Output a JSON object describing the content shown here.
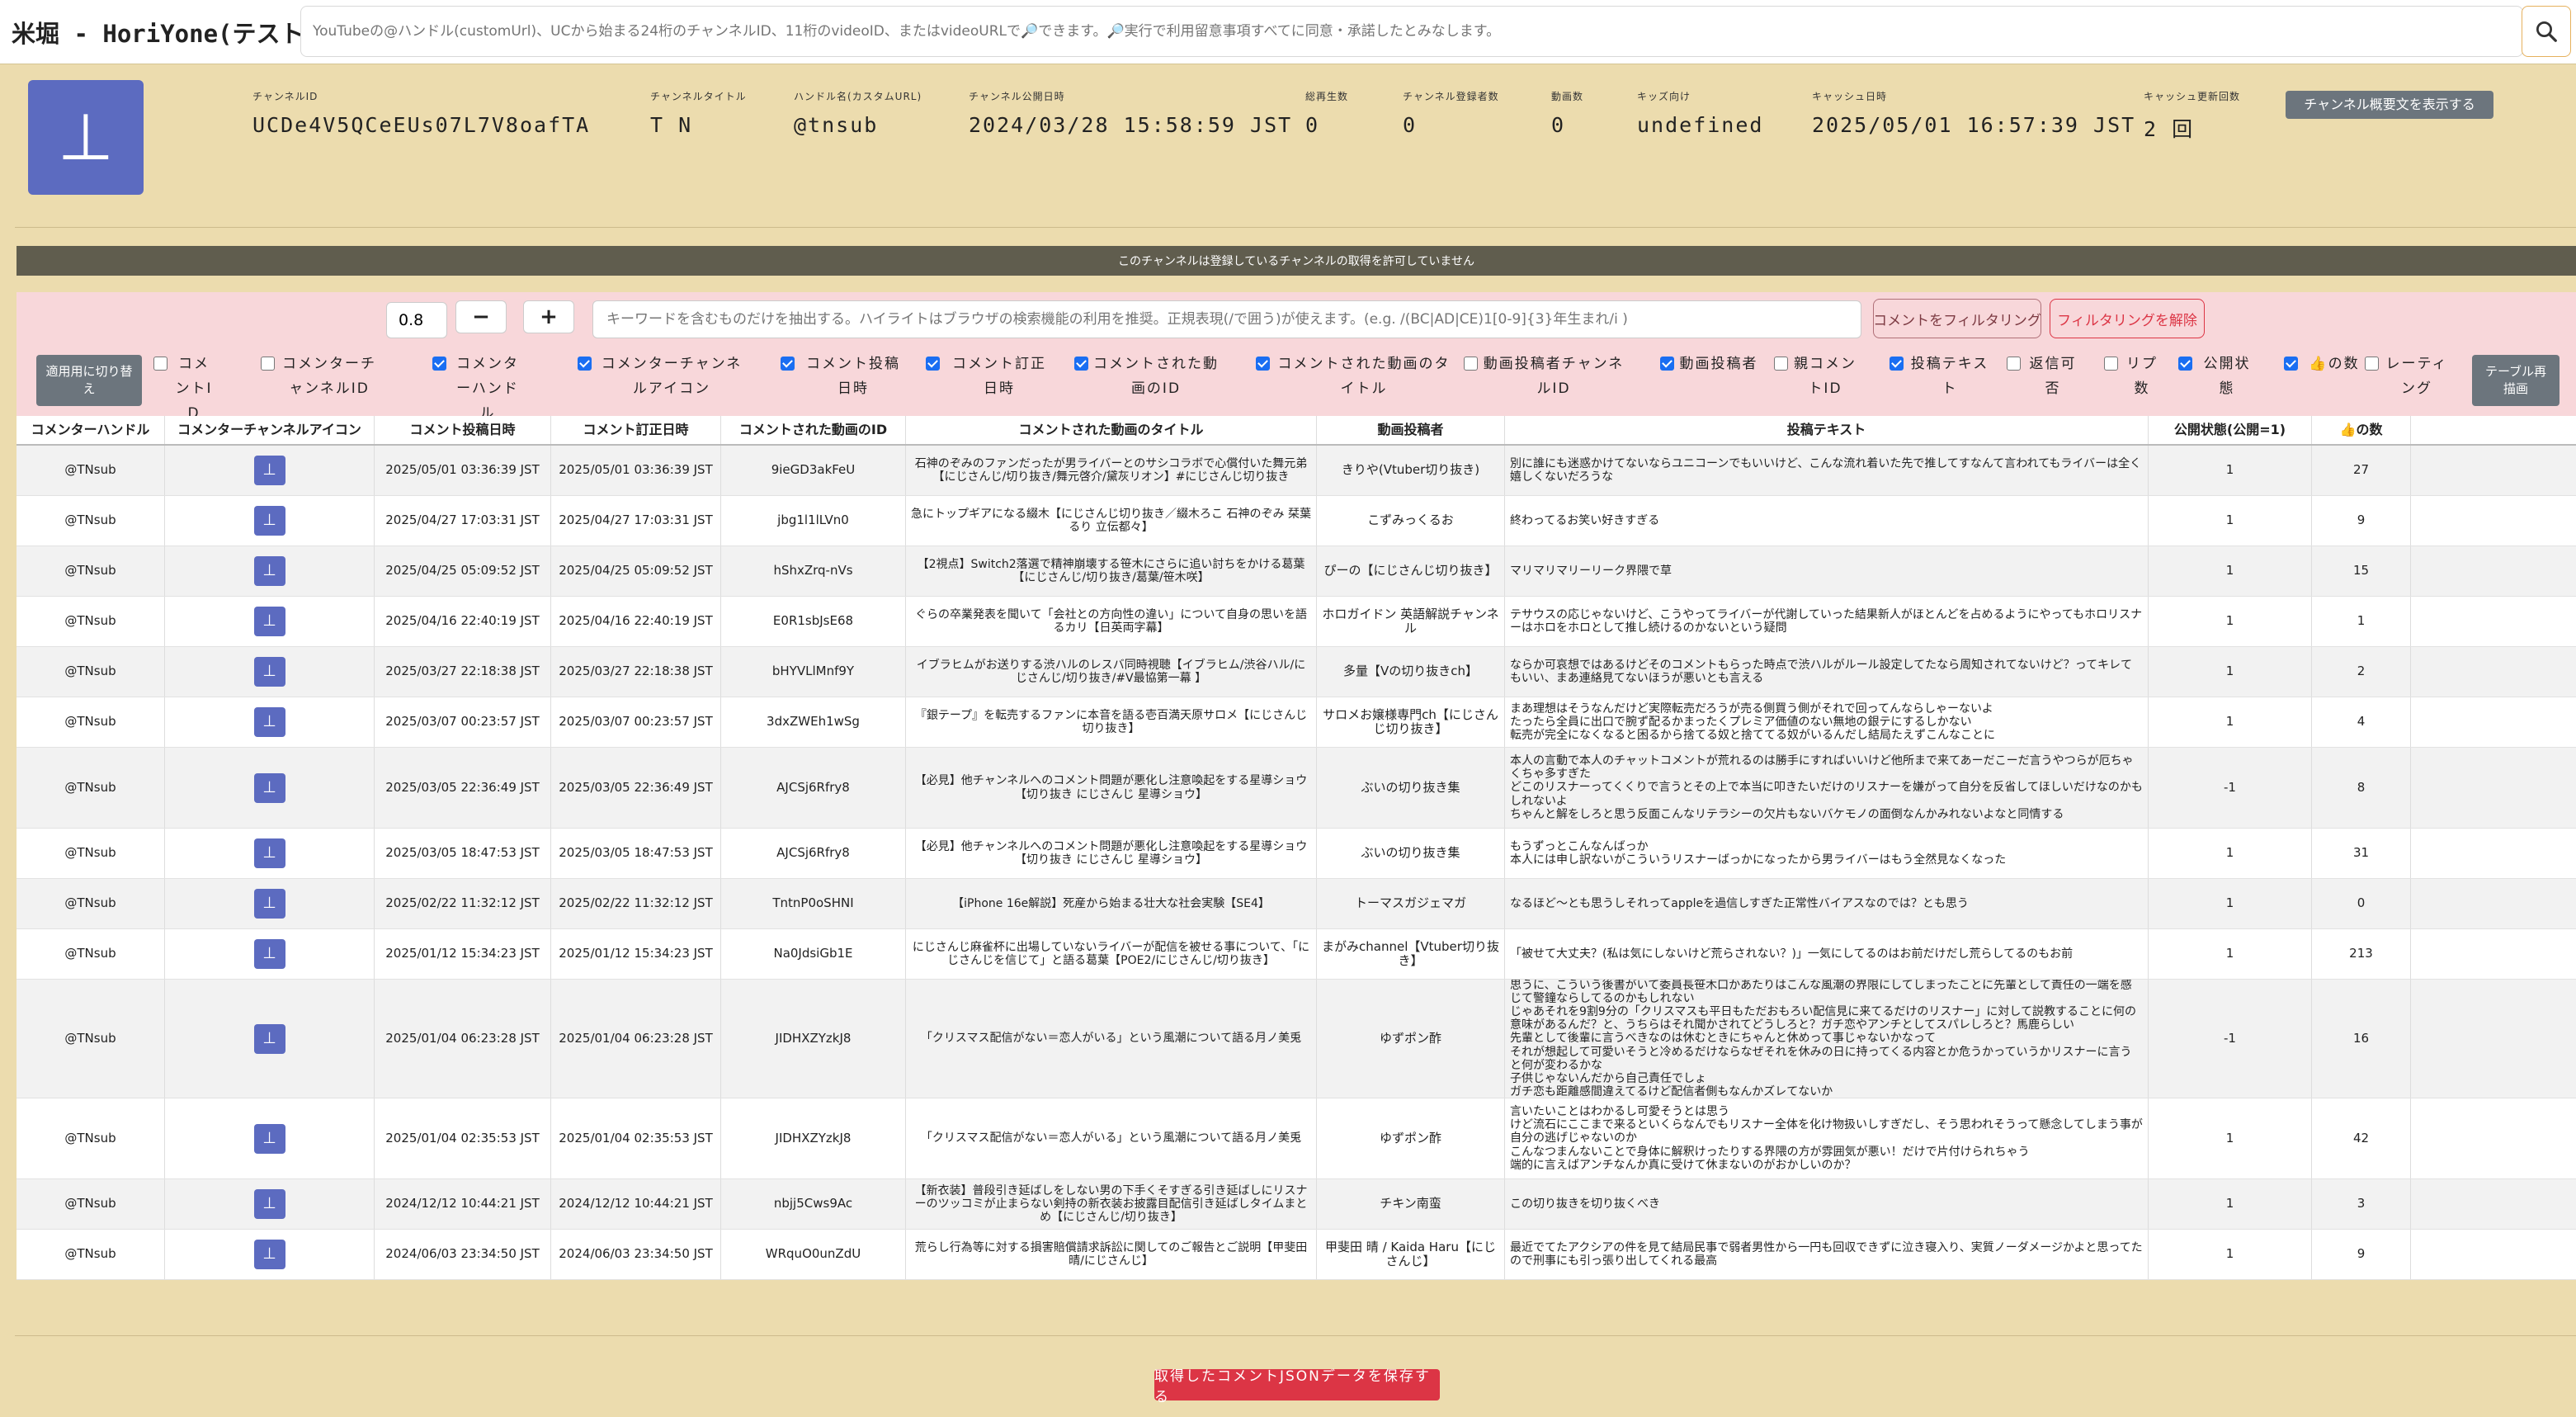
{
  "app": {
    "title": "米堀 - HoriYone(テスト中)",
    "search_placeholder": "YouTubeの@ハンドル(customUrl)、UCから始まる24桁のチャンネルID、11桁のvideoID、またはvideoURLで🔎できます。🔎実行で利用留意事項すべてに同意・承諾したとみなします。",
    "search_icon": "search-icon"
  },
  "channel": {
    "avatar_char": "⊥",
    "fields": [
      {
        "label": "チャンネルID",
        "value": "UCDe4V5QCeEUs07L7V8oafTA"
      },
      {
        "label": "チャンネルタイトル",
        "value": "T N"
      },
      {
        "label": "ハンドル名(カスタムURL)",
        "value": "@tnsub"
      },
      {
        "label": "チャンネル公開日時",
        "value": "2024/03/28 15:58:59 JST"
      },
      {
        "label": "総再生数",
        "value": "0"
      },
      {
        "label": "チャンネル登録者数",
        "value": "0"
      },
      {
        "label": "動画数",
        "value": "0"
      },
      {
        "label": "キッズ向け",
        "value": "undefined"
      },
      {
        "label": "キャッシュ日時",
        "value": "2025/05/01 16:57:39 JST"
      },
      {
        "label": "キャッシュ更新回数",
        "value": "2 回"
      }
    ],
    "show_desc_label": "チャンネル概要文を表示する"
  },
  "banner": "このチャンネルは登録しているチャンネルの取得を許可していません",
  "filter": {
    "zoom_value": "0.8",
    "minus_label": "−",
    "plus_label": "+",
    "keyword_placeholder": "キーワードを含むものだけを抽出する。ハイライトはブラウザの検索機能の利用を推奨。正規表現(/で囲う)が使えます。(e.g. /(BC|AD|CE)1[0-9]{3}年生まれ/i )",
    "filter_btn": "コメントをフィルタリング",
    "clear_btn": "フィルタリングを解除",
    "apply_btn": "適用用に切り替え",
    "redraw_btn": "テーブル再描画"
  },
  "column_toggles": [
    {
      "label": "コメントID",
      "checked": false
    },
    {
      "label": "コメンターチャンネルID",
      "checked": false
    },
    {
      "label": "コメンターハンドル",
      "checked": true
    },
    {
      "label": "コメンターチャンネルアイコン",
      "checked": true
    },
    {
      "label": "コメント投稿日時",
      "checked": true
    },
    {
      "label": "コメント訂正日時",
      "checked": true
    },
    {
      "label": "コメントされた動画のID",
      "checked": true
    },
    {
      "label": "コメントされた動画のタイトル",
      "checked": true
    },
    {
      "label": "動画投稿者チャンネルID",
      "checked": false
    },
    {
      "label": "動画投稿者",
      "checked": true
    },
    {
      "label": "親コメントID",
      "checked": false
    },
    {
      "label": "投稿テキスト",
      "checked": true
    },
    {
      "label": "返信可否",
      "checked": false
    },
    {
      "label": "リプ数",
      "checked": false
    },
    {
      "label": "公開状態",
      "checked": true
    },
    {
      "label": "👍の数",
      "checked": true
    },
    {
      "label": "レーティング",
      "checked": false
    }
  ],
  "table": {
    "headers": [
      "コメンターハンドル",
      "コメンターチャンネルアイコン",
      "コメント投稿日時",
      "コメント訂正日時",
      "コメントされた動画のID",
      "コメントされた動画のタイトル",
      "動画投稿者",
      "投稿テキスト",
      "公開状態(公開=1)",
      "👍の数"
    ],
    "rows": [
      {
        "handle": "@TNsub",
        "icon": "⊥",
        "posted": "2025/05/01 03:36:39 JST",
        "edited": "2025/05/01 03:36:39 JST",
        "video_id": "9ieGD3akFeU",
        "title": "石神のぞみのファンだったが男ライバーとのサシコラボで心償付いた舞元弟【にじさんじ/切り抜き/舞元啓介/黛灰リオン】#にじさんじ切り抜き",
        "uploader": "きりや(Vtuber切り抜き)",
        "text": "別に誰にも迷惑かけてないならユニコーンでもいいけど、こんな流れ着いた先で推してすなんて言われてもライバーは全く嬉しくないだろうな",
        "public": "1",
        "likes": "27"
      },
      {
        "handle": "@TNsub",
        "icon": "⊥",
        "posted": "2025/04/27 17:03:31 JST",
        "edited": "2025/04/27 17:03:31 JST",
        "video_id": "jbg1l1lLVn0",
        "title": "急にトップギアになる綴木【にじさんじ切り抜き／綴木ろこ 石神のぞみ 栞葉るり 立伝都々】",
        "uploader": "こずみっくるお",
        "text": "終わってるお笑い好きすぎる",
        "public": "1",
        "likes": "9"
      },
      {
        "handle": "@TNsub",
        "icon": "⊥",
        "posted": "2025/04/25 05:09:52 JST",
        "edited": "2025/04/25 05:09:52 JST",
        "video_id": "hShxZrq-nVs",
        "title": "【2視点】Switch2落選で精神崩壊する笹木にさらに追い討ちをかける葛葉【にじさんじ/切り抜き/葛葉/笹木咲】",
        "uploader": "ぴーの【にじさんじ切り抜き】",
        "text": "マリマリマリーリーク界隈で草",
        "public": "1",
        "likes": "15"
      },
      {
        "handle": "@TNsub",
        "icon": "⊥",
        "posted": "2025/04/16 22:40:19 JST",
        "edited": "2025/04/16 22:40:19 JST",
        "video_id": "E0R1sbJsE68",
        "title": "ぐらの卒業発表を聞いて「会社との方向性の違い」について自身の思いを語るカリ【日英両字幕】",
        "uploader": "ホロガイドン 英語解説チャンネル",
        "text": "テサウスの応じゃないけど、こうやってライバーが代謝していった結果新人がほとんどを占めるようにやってもホロリスナーはホロをホロとして推し続けるのかないという疑問",
        "public": "1",
        "likes": "1"
      },
      {
        "handle": "@TNsub",
        "icon": "⊥",
        "posted": "2025/03/27 22:18:38 JST",
        "edited": "2025/03/27 22:18:38 JST",
        "video_id": "bHYVLlMnf9Y",
        "title": "イブラヒムがお送りする渋ハルのレスバ同時視聴【イブラヒム/渋谷ハル/にじさんじ/切り抜き/#V最協第一幕 】",
        "uploader": "多量【Vの切り抜きch】",
        "text": "ならか可哀想ではあるけどそのコメントもらった時点で渋ハルがルール設定してたなら周知されてないけど？ってキレてもいい、まあ連絡見てないほうが悪いとも言える",
        "public": "1",
        "likes": "2"
      },
      {
        "handle": "@TNsub",
        "icon": "⊥",
        "posted": "2025/03/07 00:23:57 JST",
        "edited": "2025/03/07 00:23:57 JST",
        "video_id": "3dxZWEh1wSg",
        "title": "『銀テープ』を転売するファンに本音を語る壱百満天原サロメ【にじさんじ切り抜き】",
        "uploader": "サロメお嬢様専門ch【にじさんじ切り抜き】",
        "text": "まあ理想はそうなんだけど実際転売だろうが売る側買う側がそれで回ってんならしゃーないよ\nたったら全員に出口で腕ず配るかまったくプレミア価値のない無地の銀テにするしかない\n転売が完全になくなると困るから捨てる奴と捨ててる奴がいるんだし結局たえずこんなことに",
        "public": "1",
        "likes": "4"
      },
      {
        "handle": "@TNsub",
        "icon": "⊥",
        "posted": "2025/03/05 22:36:49 JST",
        "edited": "2025/03/05 22:36:49 JST",
        "video_id": "AJCSj6Rfry8",
        "title": "【必見】他チャンネルへのコメント問題が悪化し注意喚起をする星導ショウ【切り抜き にじさんじ 星導ショウ】",
        "uploader": "ぶいの切り抜き集",
        "text": "本人の言動で本人のチャットコメントが荒れるのは勝手にすればいいけど他所まで来てあーだこーだ言うやつらが厄ちゃくちゃ多すぎた\nどこのリスナーってくくりで言うとその上で本当に叩きたいだけのリスナーを嫌がって自分を反省してほしいだけなのかもしれないよ\nちゃんと解をしろと思う反面こんなリテラシーの欠片もないバケモノの面倒なんかみれないよなと同情する",
        "public": "-1",
        "likes": "8"
      },
      {
        "handle": "@TNsub",
        "icon": "⊥",
        "posted": "2025/03/05 18:47:53 JST",
        "edited": "2025/03/05 18:47:53 JST",
        "video_id": "AJCSj6Rfry8",
        "title": "【必見】他チャンネルへのコメント問題が悪化し注意喚起をする星導ショウ【切り抜き にじさんじ 星導ショウ】",
        "uploader": "ぶいの切り抜き集",
        "text": "もうずっとこんなんばっか\n本人には申し訳ないがこういうリスナーばっかになったから男ライバーはもう全然見なくなった",
        "public": "1",
        "likes": "31"
      },
      {
        "handle": "@TNsub",
        "icon": "⊥",
        "posted": "2025/02/22 11:32:12 JST",
        "edited": "2025/02/22 11:32:12 JST",
        "video_id": "TntnP0oSHNI",
        "title": "【iPhone 16e解説】死産から始まる壮大な社会実験【SE4】",
        "uploader": "トーマスガジェマガ",
        "text": "なるほど～とも思うしそれってappleを過信しすぎた正常性バイアスなのでは？とも思う",
        "public": "1",
        "likes": "0"
      },
      {
        "handle": "@TNsub",
        "icon": "⊥",
        "posted": "2025/01/12 15:34:23 JST",
        "edited": "2025/01/12 15:34:23 JST",
        "video_id": "Na0JdsiGb1E",
        "title": "にじさんじ麻雀杯に出場していないライバーが配信を被せる事について、「にじさんじを信じて」と語る葛葉【POE2/にじさんじ/切り抜き】",
        "uploader": "まがみchannel【Vtuber切り抜き】",
        "text": "「被せて大丈夫？(私は気にしないけど荒らされない？)」一気にしてるのはお前だけだし荒らしてるのもお前",
        "public": "1",
        "likes": "213"
      },
      {
        "handle": "@TNsub",
        "icon": "⊥",
        "posted": "2025/01/04 06:23:28 JST",
        "edited": "2025/01/04 06:23:28 JST",
        "video_id": "JIDHXZYzkJ8",
        "title": "「クリスマス配信がない＝恋人がいる」という風潮について語る月ノ美兎",
        "uploader": "ゆずポン酢",
        "text": "思うに、こういう後書がいて委員長笹木口かあたりはこんな風潮の界限にしてしまったことに先輩として責任の一端を感じて警鐘ならしてるのかもしれない\nじゃあそれを9割9分の「クリスマスも平日もただおもろい配信見に来てるだけのリスナー」に対して説教することに何の意味があるんだ？と、うちらはそれ聞かされてどうしろと？ガチ恋やアンチとしてスパレしろと？馬鹿らしい\n先輩として後輩に言うべきなのは休むときにちゃんと休めって事じゃないかなって\nそれが想起して可愛いそうと冷めるだけならなぜそれを休みの日に持ってくる内容とか危うかっていうかリスナーに言うと何が変わるかな\n子供じゃないんだから自己責任でしょ\nガチ恋も距離感間違えてるけど配信者側もなんかズレてないか",
        "public": "-1",
        "likes": "16"
      },
      {
        "handle": "@TNsub",
        "icon": "⊥",
        "posted": "2025/01/04 02:35:53 JST",
        "edited": "2025/01/04 02:35:53 JST",
        "video_id": "JIDHXZYzkJ8",
        "title": "「クリスマス配信がない＝恋人がいる」という風潮について語る月ノ美兎",
        "uploader": "ゆずポン酢",
        "text": "言いたいことはわかるし可愛そうとは思う\nけど流石にここまで来るといくらなんでもリスナー全体を化け物扱いしすぎだし、そう思われそうって懸念してしまう事が自分の逃げじゃないのか\nこんなつまんないことで身体に解釈けったりする界隈の方が雰囲気が悪い！だけで片付けられちゃう\n端的に言えばアンチなんか真に受けて休まないのがおかしいのか？",
        "public": "1",
        "likes": "42"
      },
      {
        "handle": "@TNsub",
        "icon": "⊥",
        "posted": "2024/12/12 10:44:21 JST",
        "edited": "2024/12/12 10:44:21 JST",
        "video_id": "nbjj5Cws9Ac",
        "title": "【新衣装】普段引き延ばしをしない男の下手くそすぎる引き延ばしにリスナーのツッコミが止まらない剣持の新衣装お披露目配信引き延ばしタイムまとめ【にじさんじ/切り抜き】",
        "uploader": "チキン南蛮",
        "text": "この切り抜きを切り抜くべき",
        "public": "1",
        "likes": "3"
      },
      {
        "handle": "@TNsub",
        "icon": "⊥",
        "posted": "2024/06/03 23:34:50 JST",
        "edited": "2024/06/03 23:34:50 JST",
        "video_id": "WRquO0unZdU",
        "title": "荒らし行為等に対する損害賠償請求訴訟に関してのご報告とご説明【甲斐田晴/にじさんじ】",
        "uploader": "甲斐田 晴 / Kaida Haru【にじさんじ】",
        "text": "最近でてたアクシアの件を見て結局民事で弱者男性から一円も回収できずに泣き寝入り、実質ノーダメージかよと思ってたので刑事にも引っ張り出してくれる最高",
        "public": "1",
        "likes": "9"
      }
    ]
  },
  "save_btn": "取得したコメントJSONデータを保存する"
}
